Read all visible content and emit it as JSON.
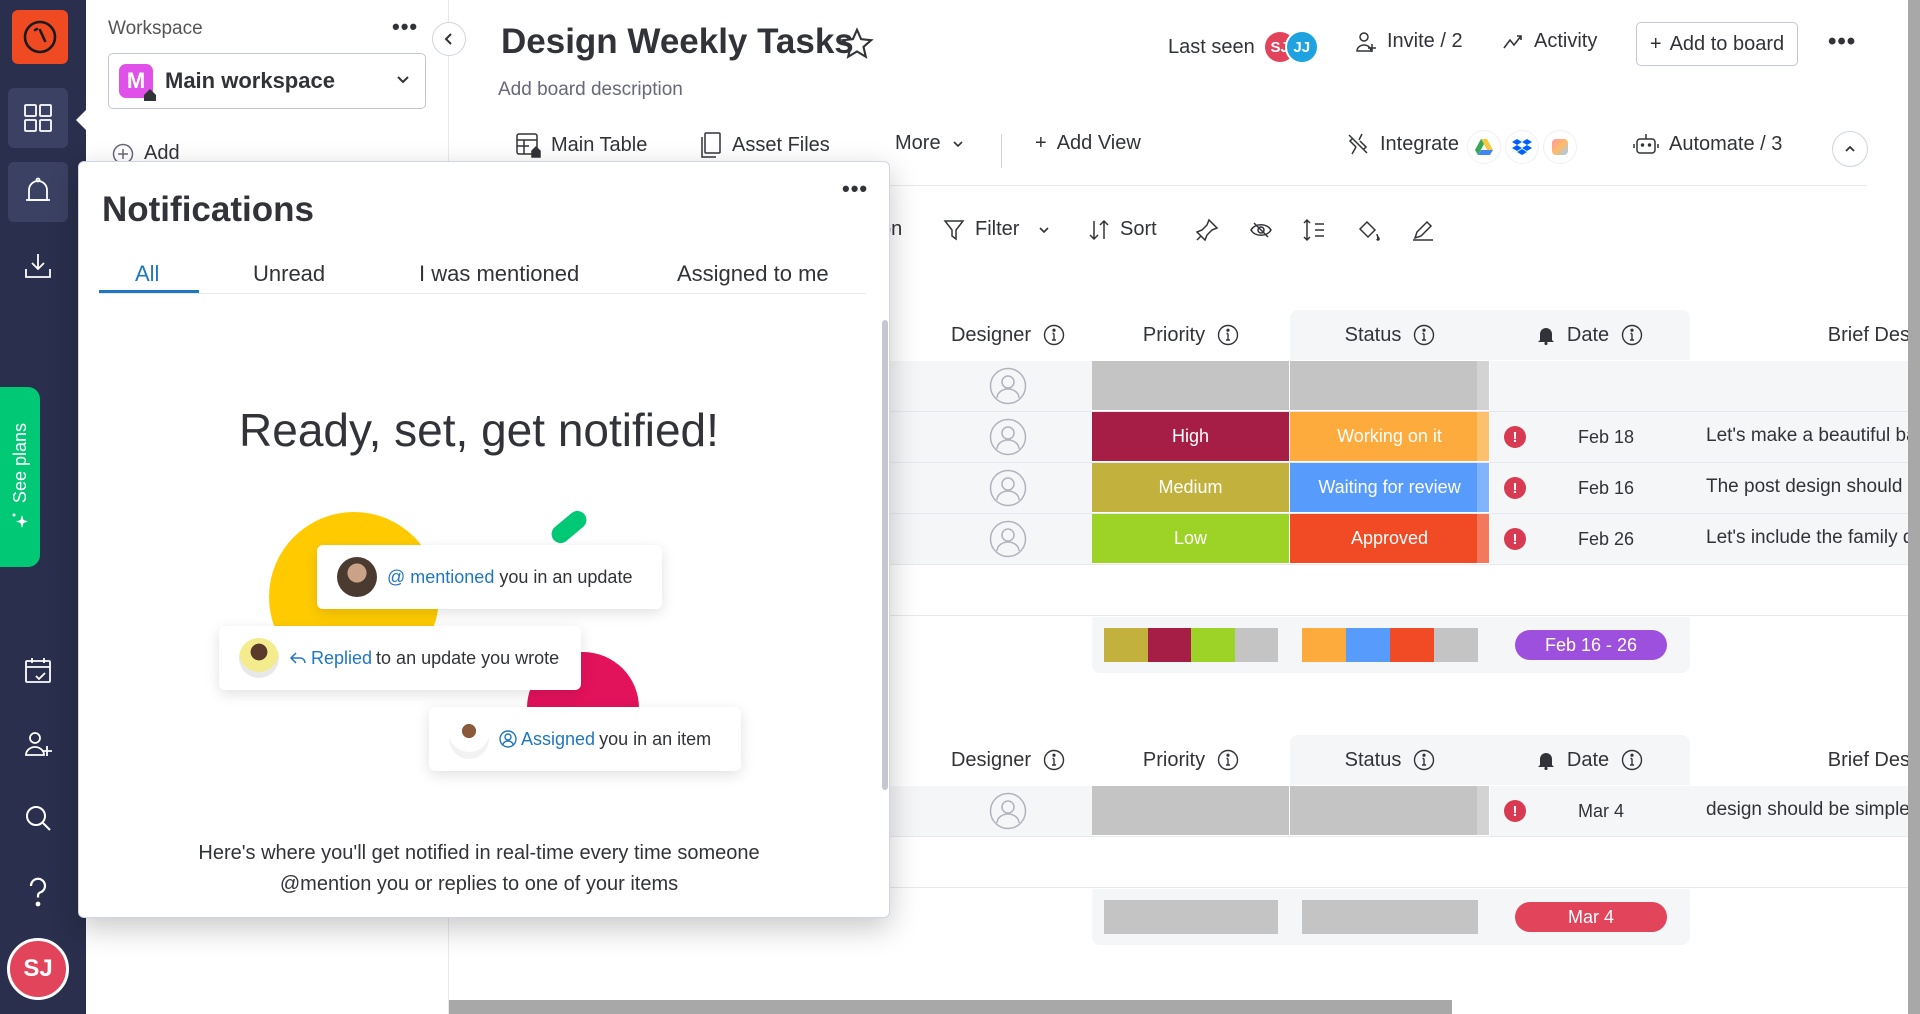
{
  "nav": {
    "logo": "monday-logo-icon",
    "items": [
      {
        "name": "workspaces",
        "icon": "grid-icon"
      },
      {
        "name": "notifications",
        "icon": "bell-icon"
      },
      {
        "name": "inbox",
        "icon": "download-icon"
      },
      {
        "name": "my-work",
        "icon": "calendar-check-icon"
      },
      {
        "name": "invite",
        "icon": "add-user-icon"
      },
      {
        "name": "search",
        "icon": "search-icon"
      },
      {
        "name": "help",
        "icon": "help-icon"
      }
    ],
    "see_plans": "See plans",
    "user_initials": "SJ"
  },
  "workspace": {
    "label": "Workspace",
    "selected": "Main workspace",
    "badge_letter": "M",
    "add_label": "Add"
  },
  "board": {
    "title": "Design Weekly Tasks",
    "description": "Add board description",
    "last_seen_label": "Last seen",
    "last_seen_users": [
      {
        "initials": "SJ",
        "color": "#e2445c"
      },
      {
        "initials": "JJ",
        "color": "#1fa3e0"
      }
    ],
    "invite_label": "Invite / 2",
    "activity_label": "Activity",
    "add_to_board_label": "Add to board",
    "views": [
      {
        "label": "Main Table",
        "icon": "table-icon"
      },
      {
        "label": "Asset Files",
        "icon": "file-icon"
      },
      {
        "label": "More",
        "icon": "chevron-down-icon"
      }
    ],
    "add_view_label": "Add View",
    "integrate_label": "Integrate",
    "automate_label": "Automate / 3",
    "toolbar": {
      "partial_label": "on",
      "filter_label": "Filter",
      "sort_label": "Sort"
    }
  },
  "table": {
    "columns": [
      "Designer",
      "Priority",
      "Status",
      "Date",
      "Brief Des"
    ],
    "groups": [
      {
        "rows": [
          {
            "priority": "",
            "priority_color": "#c4c4c4",
            "status": "",
            "status_color": "#c4c4c4",
            "date": "",
            "alert": false,
            "brief": ""
          },
          {
            "priority": "High",
            "priority_color": "#a61d46",
            "status": "Working on it",
            "status_color": "#fdab3d",
            "date": "Feb 18",
            "alert": true,
            "brief": "Let's make a beautiful ba"
          },
          {
            "priority": "Medium",
            "priority_color": "#c2b23d",
            "status": "Waiting for review",
            "status_color": "#579bfc",
            "date": "Feb 16",
            "alert": true,
            "brief": "The post design should h"
          },
          {
            "priority": "Low",
            "priority_color": "#9cd326",
            "status": "Approved",
            "status_color": "#f04b24",
            "date": "Feb 26",
            "alert": true,
            "brief": "Let's include the family d"
          }
        ],
        "summary": {
          "priority_colors": [
            "#c2b23d",
            "#a61d46",
            "#9cd326",
            "#c4c4c4"
          ],
          "status_colors": [
            "#fdab3d",
            "#579bfc",
            "#f04b24",
            "#c4c4c4"
          ],
          "date_range": "Feb 16 - 26",
          "date_color": "#9d50dd"
        }
      },
      {
        "rows": [
          {
            "priority": "",
            "priority_color": "#c4c4c4",
            "status": "",
            "status_color": "#c4c4c4",
            "date": "Mar 4",
            "alert": true,
            "brief": "design should be simple"
          }
        ],
        "summary": {
          "priority_colors": [
            "#c4c4c4"
          ],
          "status_colors": [
            "#c4c4c4"
          ],
          "date_range": "Mar 4",
          "date_color": "#e2445c"
        }
      }
    ]
  },
  "notifications": {
    "title": "Notifications",
    "tabs": [
      "All",
      "Unread",
      "I was mentioned",
      "Assigned to me"
    ],
    "active_tab": "All",
    "headline": "Ready, set, get notified!",
    "cards": [
      {
        "highlight": "@ mentioned",
        "text": " you in an update"
      },
      {
        "highlight": "Replied",
        "text": " to an update you wrote"
      },
      {
        "highlight": "Assigned",
        "text": " you in an item"
      }
    ],
    "footer_line1": "Here's where you'll get notified in real-time every time someone",
    "footer_line2": "@mention you or replies to one of your items"
  },
  "colors": {
    "accent": "#1f76c2",
    "nav_bg": "#292f4c",
    "logo": "#f04a23",
    "see_plans": "#00c875"
  }
}
